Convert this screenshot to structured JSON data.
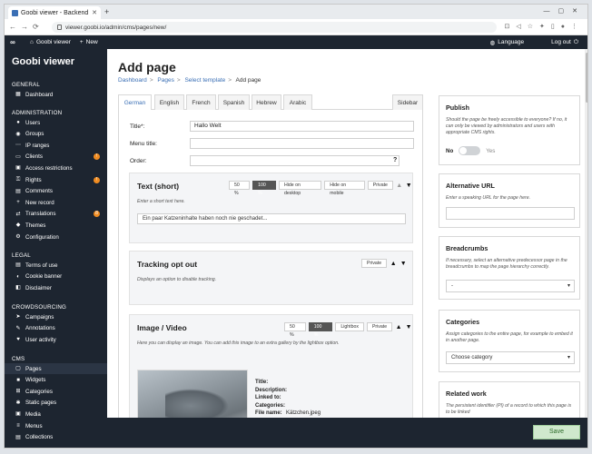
{
  "browser": {
    "tab_title": "Goobi viewer - Backend",
    "url": "viewer.goobi.io/admin/cms/pages/new/"
  },
  "topbar": {
    "logo": "∞",
    "home_label": "Goobi viewer",
    "new_label": "New",
    "language_label": "Language",
    "logout_label": "Log out"
  },
  "sidebar": {
    "brand": "Goobi viewer",
    "general": {
      "heading": "GENERAL",
      "items": [
        {
          "label": "Dashboard",
          "icon": "dashboard-icon"
        }
      ]
    },
    "administration": {
      "heading": "ADMINISTRATION",
      "items": [
        {
          "label": "Users",
          "icon": "user-icon"
        },
        {
          "label": "Groups",
          "icon": "group-icon"
        },
        {
          "label": "IP ranges",
          "icon": "network-icon"
        },
        {
          "label": "Clients",
          "icon": "client-icon",
          "badge": "!"
        },
        {
          "label": "Access restrictions",
          "icon": "lock-icon"
        },
        {
          "label": "Rights",
          "icon": "key-icon",
          "badge": "!"
        },
        {
          "label": "Comments",
          "icon": "comment-icon"
        },
        {
          "label": "New record",
          "icon": "plus-icon"
        },
        {
          "label": "Translations",
          "icon": "translate-icon",
          "badge": "8"
        },
        {
          "label": "Themes",
          "icon": "theme-icon"
        },
        {
          "label": "Configuration",
          "icon": "gear-icon"
        }
      ]
    },
    "legal": {
      "heading": "LEGAL",
      "items": [
        {
          "label": "Terms of use",
          "icon": "document-icon"
        },
        {
          "label": "Cookie banner",
          "icon": "cookie-icon"
        },
        {
          "label": "Disclaimer",
          "icon": "disclaimer-icon"
        }
      ]
    },
    "crowdsourcing": {
      "heading": "CROWDSOURCING",
      "items": [
        {
          "label": "Campaigns",
          "icon": "campaign-icon"
        },
        {
          "label": "Annotations",
          "icon": "annotation-icon"
        },
        {
          "label": "User activity",
          "icon": "activity-icon"
        }
      ]
    },
    "cms": {
      "heading": "CMS",
      "items": [
        {
          "label": "Pages",
          "icon": "pages-icon",
          "active": true
        },
        {
          "label": "Widgets",
          "icon": "widget-icon"
        },
        {
          "label": "Categories",
          "icon": "category-icon"
        },
        {
          "label": "Static pages",
          "icon": "static-pages-icon"
        },
        {
          "label": "Media",
          "icon": "media-icon"
        },
        {
          "label": "Menus",
          "icon": "menu-icon"
        },
        {
          "label": "Collections",
          "icon": "collection-icon"
        }
      ]
    }
  },
  "main": {
    "title": "Add page",
    "breadcrumb": [
      {
        "label": "Dashboard"
      },
      {
        "label": "Pages"
      },
      {
        "label": "Select template"
      },
      {
        "label": "Add page"
      }
    ],
    "tabs": [
      "German",
      "English",
      "French",
      "Spanish",
      "Hebrew",
      "Arabic"
    ],
    "sidebar_tab": "Sidebar",
    "form": {
      "title_label": "Title*:",
      "title_value": "Hallo Welt",
      "menu_title_label": "Menu title:",
      "menu_title_value": "",
      "order_label": "Order:",
      "order_value": "",
      "help": "?"
    },
    "components": [
      {
        "title": "Text (short)",
        "buttons": [
          "50 %",
          "100 %",
          "Hide on desktop",
          "Hide on mobile",
          "Private"
        ],
        "active_button": "100 %",
        "description": "Enter a short text here.",
        "input_value": "Ein paar Katzeninhalte haben noch nie geschadet..."
      },
      {
        "title": "Tracking opt out",
        "buttons": [
          "Private"
        ],
        "description": "Displays an option to disable tracking."
      },
      {
        "title": "Image / Video",
        "buttons": [
          "50 %",
          "100 %",
          "Lightbox",
          "Private"
        ],
        "active_button": "100 %",
        "description": "Here you can display an image. You can add this image to an extra gallery by the lightbox option.",
        "meta": [
          {
            "k": "Title:",
            "v": ""
          },
          {
            "k": "Description:",
            "v": ""
          },
          {
            "k": "Linked to:",
            "v": ""
          },
          {
            "k": "Categories:",
            "v": ""
          },
          {
            "k": "File name:",
            "v": "Kätzchen.jpeg"
          }
        ]
      }
    ]
  },
  "right": {
    "publish": {
      "title": "Publish",
      "desc": "Should the page be freely accessible to everyone? If no, it can only be viewed by administrators and users with appropriate CMS rights.",
      "no": "No",
      "yes": "Yes",
      "value": false
    },
    "alt_url": {
      "title": "Alternative URL",
      "desc": "Enter a speaking URL for the page here.",
      "value": ""
    },
    "breadcrumbs": {
      "title": "Breadcrumbs",
      "desc": "If necessary, select an alternative predecessor page in the breadcrumbs to map the page hierarchy correctly.",
      "value": "-"
    },
    "categories": {
      "title": "Categories",
      "desc": "Assign categories to the entire page, for example to embed it in another page.",
      "value": "Choose category"
    },
    "related": {
      "title": "Related work",
      "desc": "The persistent identifier (PI) of a record to which this page is to be linked"
    }
  },
  "footer": {
    "save_label": "Save"
  }
}
